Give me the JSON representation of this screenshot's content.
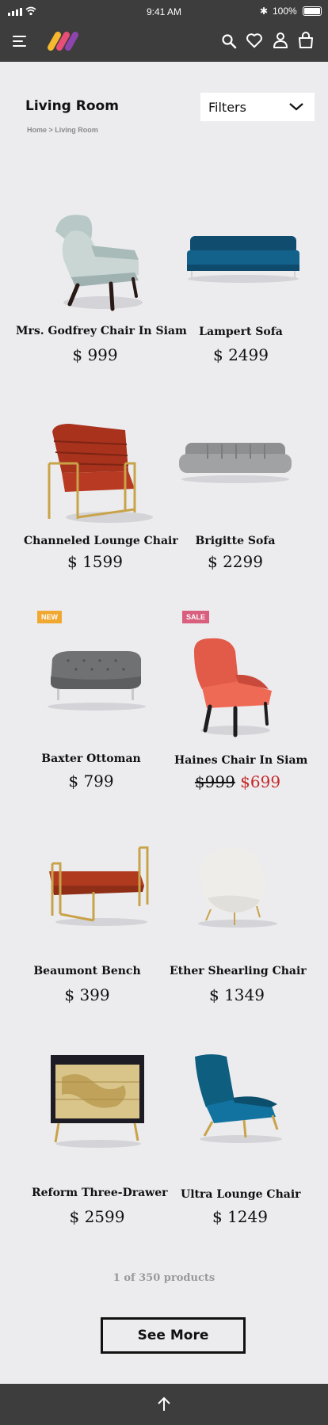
{
  "status_bar": {
    "time": "9:41 AM",
    "battery": "100%"
  },
  "nav": {
    "icons": [
      "menu-icon",
      "brand-logo",
      "search-icon",
      "heart-icon",
      "user-icon",
      "shopping-bag-icon"
    ],
    "logo_colors": [
      "#f5b82e",
      "#e94e77",
      "#8e44ad"
    ]
  },
  "page": {
    "title": "Living Room",
    "filters_label": "Filters",
    "breadcrumb": "Home > Living Room"
  },
  "products": [
    {
      "name": "Mrs. Godfrey Chair In Siam",
      "price": "$ 999"
    },
    {
      "name": "Lampert Sofa",
      "price": "$ 2499"
    },
    {
      "name": "Channeled Lounge Chair",
      "price": "$ 1599"
    },
    {
      "name": "Brigitte Sofa",
      "price": "$ 2299"
    },
    {
      "name": "Baxter Ottoman",
      "price": "$ 799",
      "badge": "NEW"
    },
    {
      "name": "Haines Chair In Siam",
      "old_price": "$999",
      "sale_price": "$699",
      "badge": "SALE"
    },
    {
      "name": "Beaumont Bench",
      "price": "$ 399"
    },
    {
      "name": "Ether Shearling Chair",
      "price": "$ 1349"
    },
    {
      "name": "Reform Three-Drawer",
      "price": "$ 2599"
    },
    {
      "name": "Ultra Lounge Chair",
      "price": "$ 1249"
    }
  ],
  "badge_colors": {
    "new": "#f0a830",
    "sale": "#d95f7f"
  },
  "pagination": {
    "count": "1 of 350 products",
    "see_more": "See More"
  }
}
